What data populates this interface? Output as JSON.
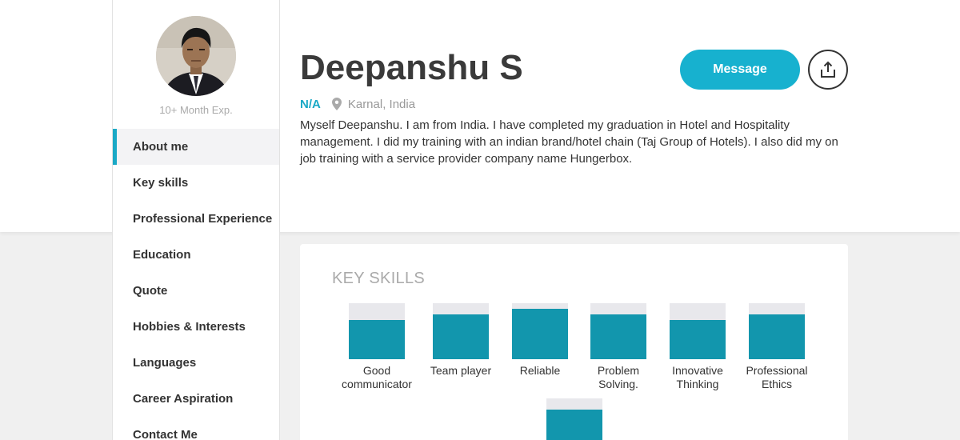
{
  "profile": {
    "name": "Deepanshu S",
    "experience": "10+ Month Exp.",
    "role": "N/A",
    "location": "Karnal, India",
    "bio": "Myself Deepanshu. I am from India. I have completed my graduation in Hotel and Hospitality management. I did my training with an indian brand/hotel chain (Taj Group of Hotels). I also did my on job training with a service provider company name Hungerbox."
  },
  "actions": {
    "message_label": "Message",
    "share_icon": "share-upload-icon"
  },
  "sidebar": {
    "items": [
      {
        "label": "About me"
      },
      {
        "label": "Key skills"
      },
      {
        "label": "Professional Experience"
      },
      {
        "label": "Education"
      },
      {
        "label": "Quote"
      },
      {
        "label": "Hobbies & Interests"
      },
      {
        "label": "Languages"
      },
      {
        "label": "Career Aspiration"
      },
      {
        "label": "Contact Me"
      }
    ],
    "active_index": 0
  },
  "key_skills": {
    "title": "KEY SKILLS",
    "items": [
      {
        "label": "Good communicator",
        "level": 0.7
      },
      {
        "label": "Team player",
        "level": 0.8
      },
      {
        "label": "Reliable",
        "level": 0.9
      },
      {
        "label": "Problem Solving.",
        "level": 0.8
      },
      {
        "label": "Innovative Thinking",
        "level": 0.7
      },
      {
        "label": "Professional Ethics",
        "level": 0.8
      },
      {
        "label": "",
        "level": 0.8
      }
    ]
  },
  "colors": {
    "accent": "#1aa9c6",
    "button": "#17b1cf",
    "skill_fill": "#1296ad",
    "skill_track": "#e8e8ec"
  }
}
